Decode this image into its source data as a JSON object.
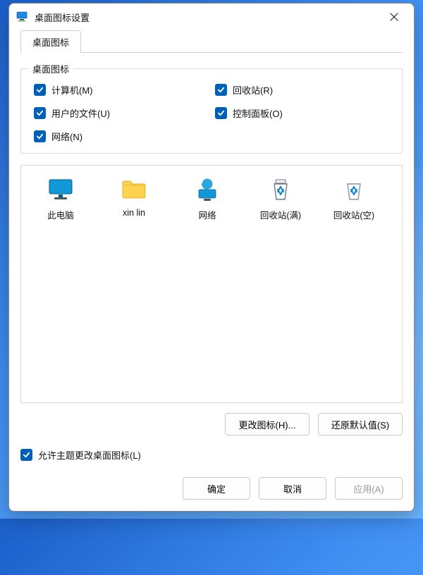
{
  "window": {
    "title": "桌面图标设置"
  },
  "tab": {
    "label": "桌面图标"
  },
  "group": {
    "legend": "桌面图标",
    "items": [
      {
        "label": "计算机(M)",
        "checked": true
      },
      {
        "label": "回收站(R)",
        "checked": true
      },
      {
        "label": "用户的文件(U)",
        "checked": true
      },
      {
        "label": "控制面板(O)",
        "checked": true
      },
      {
        "label": "网络(N)",
        "checked": true
      }
    ]
  },
  "icons": [
    {
      "label": "此电脑",
      "kind": "pc"
    },
    {
      "label": "xin lin",
      "kind": "folder"
    },
    {
      "label": "网络",
      "kind": "net"
    },
    {
      "label": "回收站(满)",
      "kind": "bin-full"
    },
    {
      "label": "回收站(空)",
      "kind": "bin-empty"
    }
  ],
  "buttons": {
    "change_icon": "更改图标(H)...",
    "restore_defaults": "还原默认值(S)"
  },
  "allow_themes": {
    "label": "允许主题更改桌面图标(L)",
    "checked": true
  },
  "footer": {
    "ok": "确定",
    "cancel": "取消",
    "apply": "应用(A)",
    "apply_enabled": false
  }
}
